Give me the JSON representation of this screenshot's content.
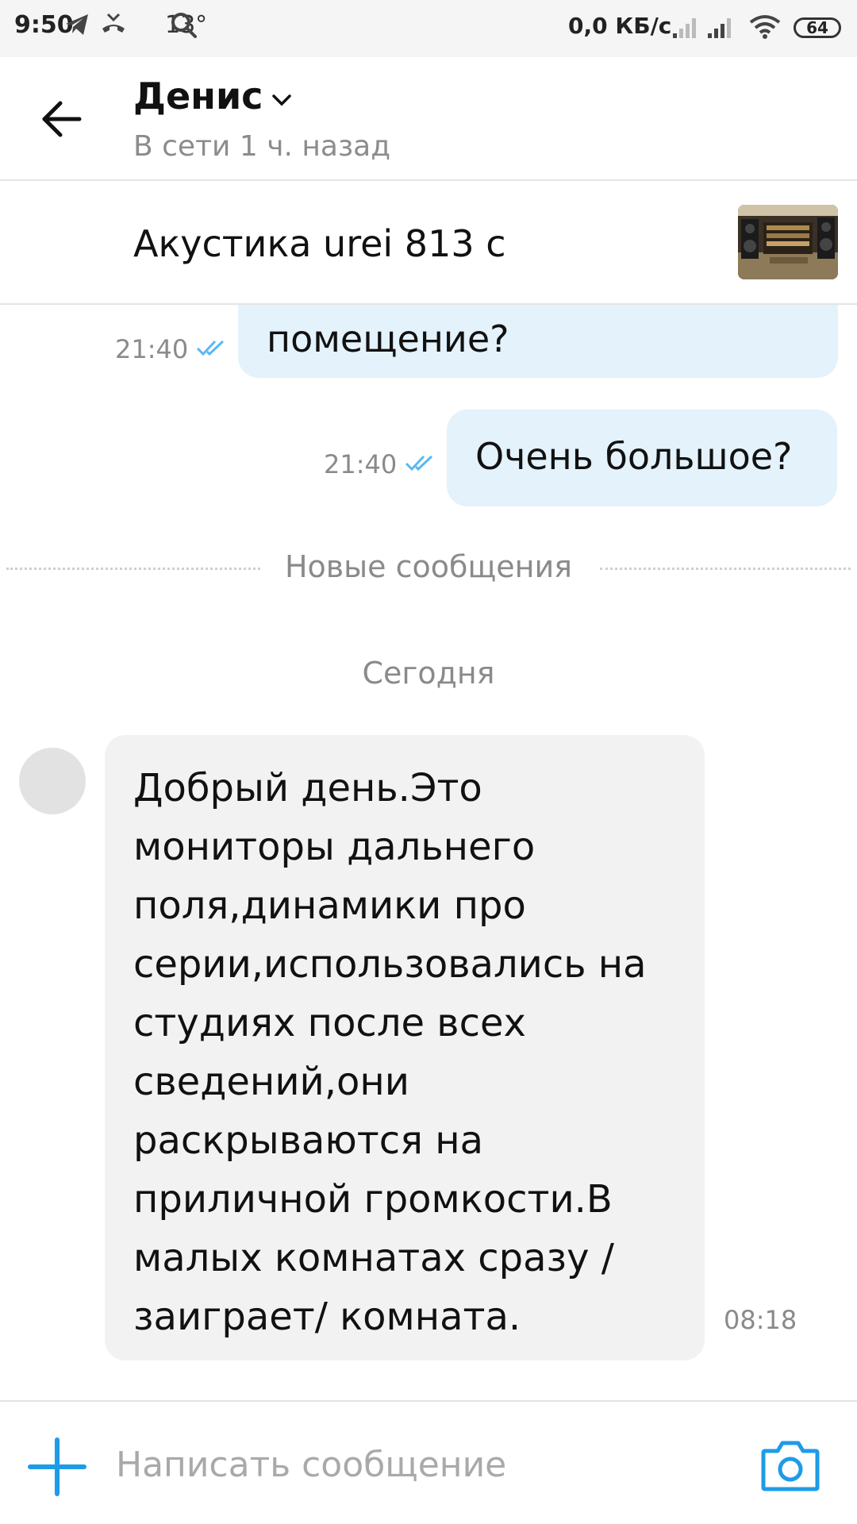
{
  "status_bar": {
    "time": "9:50",
    "temperature": "13°",
    "net_speed": "0,0 КБ/с",
    "battery": "64"
  },
  "header": {
    "contact_name": "Денис",
    "contact_status": "В сети 1 ч. назад"
  },
  "item": {
    "title": "Акустика urei 813 c"
  },
  "messages": {
    "outgoing": [
      {
        "text": "помещение?",
        "time": "21:40"
      },
      {
        "text": "Очень большое?",
        "time": "21:40"
      }
    ],
    "new_divider": "Новые сообщения",
    "day_label": "Сегодня",
    "incoming": {
      "lines": [
        "Добрый день.Это",
        "мониторы дальнего",
        "поля,динамики про",
        "серии,использовались на",
        "студиях после всех",
        "сведений,они",
        "раскрываются на",
        "приличной громкости.В",
        "малых комнатах сразу  /",
        "заиграет/ комната."
      ],
      "time": "08:18"
    }
  },
  "composer": {
    "placeholder": "Написать сообщение"
  },
  "colors": {
    "accent": "#1e9be8",
    "outgoing_bubble": "#e3f2fb",
    "incoming_bubble": "#f2f2f2",
    "read_tick": "#5cb8f0"
  },
  "icons": {
    "back": "arrow-left-icon",
    "dropdown": "chevron-down-icon",
    "add": "plus-icon",
    "camera": "camera-icon",
    "read": "double-check-icon"
  }
}
